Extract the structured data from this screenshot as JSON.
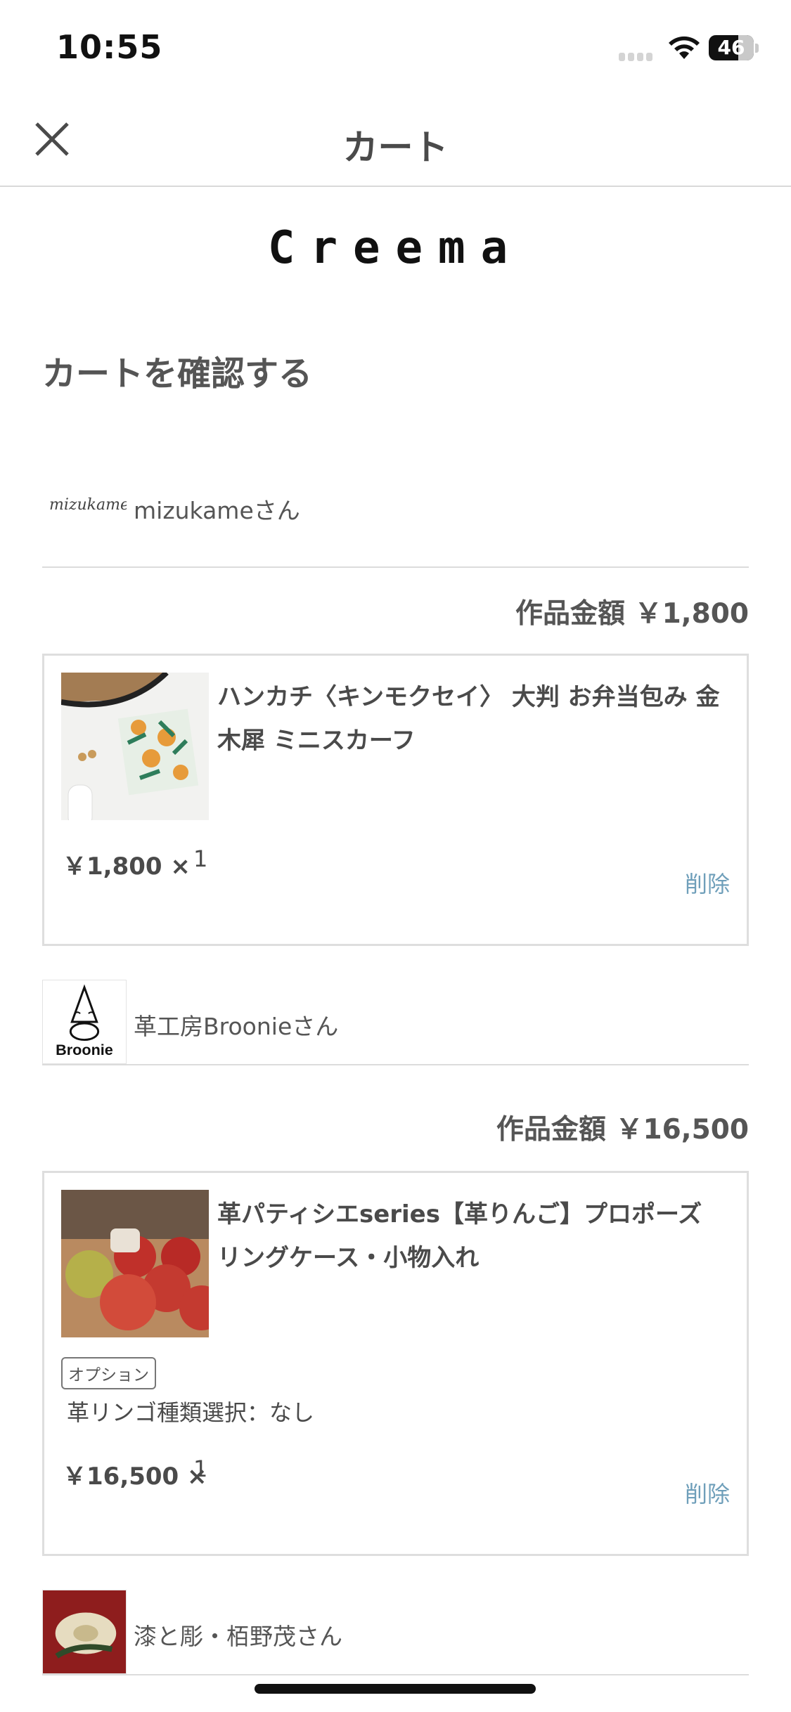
{
  "status_bar": {
    "time": "10:55",
    "battery": "46"
  },
  "header": {
    "title": "カート",
    "close_icon": "close-icon"
  },
  "brand": {
    "logo": "Creema"
  },
  "page": {
    "heading": "カートを確認する"
  },
  "shops": [
    {
      "logo_text": "mizukame",
      "name": "mizukameさん",
      "subtotal": "作品金額 ￥1,800",
      "item": {
        "title": "ハンカチ〈キンモクセイ〉 大判 お弁当包み 金木犀 ミニスカーフ",
        "price": "￥1,800 ×",
        "qty": "1",
        "delete": "削除"
      }
    },
    {
      "logo_text": "Broonie",
      "name": "革工房Broonieさん",
      "subtotal": "作品金額 ￥16,500",
      "item": {
        "title": "革パティシエseries【革りんご】プロポーズリングケース・小物入れ",
        "option_label": "オプション",
        "option_value": "革リンゴ種類選択：なし",
        "price": "￥16,500 ×",
        "qty": "1",
        "delete": "削除"
      }
    },
    {
      "name": "漆と彫・栢野茂さん"
    }
  ],
  "colors": {
    "accent_link": "#6f9fba",
    "border": "#dedede",
    "text": "#4a4a4a"
  }
}
